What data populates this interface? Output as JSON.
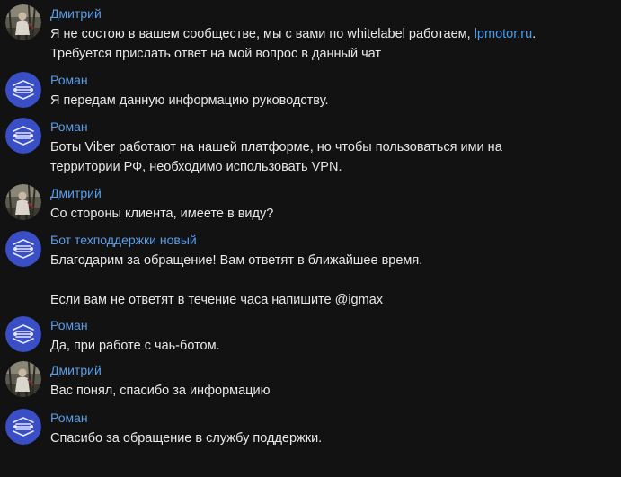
{
  "colors": {
    "background": "#121212",
    "author": "#5b9ee8",
    "text": "#e8e8e8",
    "link": "#4a9df0",
    "bot_avatar": "#3a4ec6"
  },
  "messages": [
    {
      "author": "Дмитрий",
      "avatar": "user-photo",
      "lines": [
        {
          "before": "Я не состою в вашем сообществе, мы с вами по whitelabel работаем, ",
          "link": "lpmotor.ru",
          "after": "."
        },
        {
          "before": "Требуется прислать ответ на мой вопрос в данный чат",
          "link": "",
          "after": ""
        }
      ]
    },
    {
      "author": "Роман",
      "avatar": "bot-logo",
      "lines": [
        {
          "before": "Я передам данную информацию руководству.",
          "link": "",
          "after": ""
        }
      ]
    },
    {
      "author": "Роман",
      "avatar": "bot-logo",
      "lines": [
        {
          "before": "Боты Viber работают на нашей платформе, но чтобы пользоваться ими на",
          "link": "",
          "after": ""
        },
        {
          "before": "территории РФ, необходимо использовать VPN.",
          "link": "",
          "after": ""
        }
      ]
    },
    {
      "author": "Дмитрий",
      "avatar": "user-photo",
      "lines": [
        {
          "before": "Со стороны клиента, имеете в виду?",
          "link": "",
          "after": ""
        }
      ]
    },
    {
      "author": "Бот техподдержки новый",
      "avatar": "bot-logo",
      "lines": [
        {
          "before": "Благодарим за обращение! Вам ответят в ближайшее время.",
          "link": "",
          "after": ""
        },
        {
          "before": "",
          "link": "",
          "after": ""
        },
        {
          "before": "Если вам не ответят в течение часа напишите @igmax",
          "link": "",
          "after": ""
        }
      ]
    },
    {
      "author": "Роман",
      "avatar": "bot-logo",
      "lines": [
        {
          "before": "Да, при работе с чаь-ботом.",
          "link": "",
          "after": ""
        }
      ]
    },
    {
      "author": "Дмитрий",
      "avatar": "user-photo",
      "lines": [
        {
          "before": "Вас понял, спасибо за информацию",
          "link": "",
          "after": ""
        }
      ]
    },
    {
      "author": "Роман",
      "avatar": "bot-logo",
      "lines": [
        {
          "before": "Спасибо за обращение в службу поддержки.",
          "link": "",
          "after": ""
        }
      ]
    }
  ]
}
